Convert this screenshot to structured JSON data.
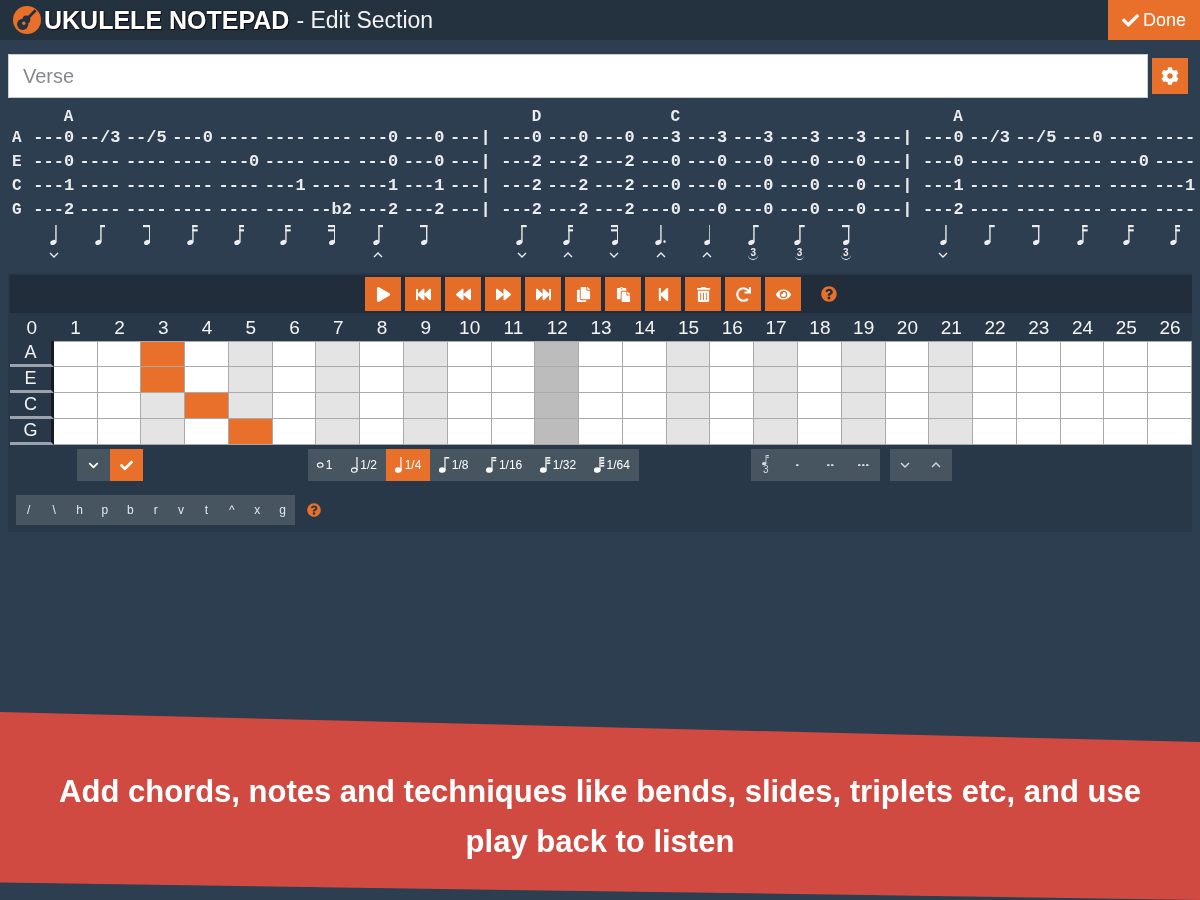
{
  "header": {
    "app_name": "UKULELE NOTEPAD",
    "title": "- Edit Section",
    "done_button": "Done"
  },
  "section_name": {
    "value": "Verse"
  },
  "tab": {
    "string_names": [
      "A",
      "E",
      "C",
      "G"
    ],
    "measures": [
      {
        "beats": [
          {
            "chord": "A",
            "strings": [
              "---0",
              "---0",
              "---1",
              "---2"
            ],
            "kind": "quarter",
            "accent": {
              "kind": "down"
            }
          },
          {
            "strings": [
              "--/3",
              "----",
              "----",
              "----"
            ],
            "kind": "eighth-beam-right"
          },
          {
            "strings": [
              "--/5",
              "----",
              "----",
              "----"
            ],
            "kind": "eighth-beam-left"
          },
          {
            "strings": [
              "---0",
              "----",
              "----",
              "----"
            ],
            "kind": "sixteenth-beam-right"
          },
          {
            "strings": [
              "----",
              "---0",
              "----",
              "----"
            ],
            "kind": "sixteenth-beam-right"
          },
          {
            "strings": [
              "----",
              "----",
              "---1",
              "----"
            ],
            "kind": "sixteenth-beam-right"
          },
          {
            "strings": [
              "----",
              "----",
              "----",
              "--b2"
            ],
            "kind": "sixteenth-beam-left"
          },
          {
            "strings": [
              "---0",
              "---0",
              "---1",
              "---2"
            ],
            "kind": "eighth-beam-right",
            "accent": {
              "kind": "up"
            }
          },
          {
            "strings": [
              "---0",
              "---0",
              "---1",
              "---2"
            ],
            "kind": "eighth-beam-left"
          }
        ],
        "bar": [
          "---|",
          "---|",
          "---|",
          "---|"
        ]
      },
      {
        "beats": [
          {
            "chord": "D",
            "strings": [
              "---0",
              "---2",
              "---2",
              "---2"
            ],
            "kind": "eighth-beam-right",
            "accent": {
              "kind": "down"
            }
          },
          {
            "strings": [
              "---0",
              "---2",
              "---2",
              "---2"
            ],
            "kind": "sixteenth-beam-right",
            "accent": {
              "kind": "up"
            }
          },
          {
            "strings": [
              "---0",
              "---2",
              "---2",
              "---2"
            ],
            "kind": "sixteenth-beam-left",
            "accent": {
              "kind": "down"
            }
          },
          {
            "chord": "C",
            "strings": [
              "---3",
              "---0",
              "---0",
              "---0"
            ],
            "kind": "dotted-quarter",
            "accent": {
              "kind": "up"
            }
          },
          {
            "strings": [
              "---3",
              "---0",
              "---0",
              "---0"
            ],
            "kind": "quarter",
            "accent": {
              "kind": "up"
            }
          },
          {
            "strings": [
              "---3",
              "---0",
              "---0",
              "---0"
            ],
            "kind": "eighth-beam-right",
            "tuplet": "3"
          },
          {
            "strings": [
              "---3",
              "---0",
              "---0",
              "---0"
            ],
            "kind": "eighth-beam-right",
            "tuplet": "3"
          },
          {
            "strings": [
              "---3",
              "---0",
              "---0",
              "---0"
            ],
            "kind": "eighth-beam-left",
            "tuplet": "3"
          }
        ],
        "bar": [
          "---|",
          "---|",
          "---|",
          "---|"
        ]
      },
      {
        "beats": [
          {
            "chord": "A",
            "strings": [
              "---0",
              "---0",
              "---1",
              "---2"
            ],
            "kind": "quarter",
            "accent": {
              "kind": "down"
            }
          },
          {
            "strings": [
              "--/3",
              "----",
              "----",
              "----"
            ],
            "kind": "eighth-beam-right"
          },
          {
            "strings": [
              "--/5",
              "----",
              "----",
              "----"
            ],
            "kind": "eighth-beam-left"
          },
          {
            "strings": [
              "---0",
              "----",
              "----",
              "----"
            ],
            "kind": "sixteenth-beam-right"
          },
          {
            "strings": [
              "----",
              "---0",
              "----",
              "----"
            ],
            "kind": "sixteenth-beam-right"
          },
          {
            "strings": [
              "----",
              "----",
              "---1",
              "----"
            ],
            "kind": "sixteenth-beam-right"
          }
        ]
      }
    ]
  },
  "fretboard": {
    "open_label": "0",
    "frets": [
      {
        "number": "1",
        "kind": "plain"
      },
      {
        "number": "2",
        "kind": "plain"
      },
      {
        "number": "3",
        "kind": "marker"
      },
      {
        "number": "4",
        "kind": "plain"
      },
      {
        "number": "5",
        "kind": "marker"
      },
      {
        "number": "6",
        "kind": "plain"
      },
      {
        "number": "7",
        "kind": "marker"
      },
      {
        "number": "8",
        "kind": "plain"
      },
      {
        "number": "9",
        "kind": "marker"
      },
      {
        "number": "10",
        "kind": "plain"
      },
      {
        "number": "11",
        "kind": "plain"
      },
      {
        "number": "12",
        "kind": "double-marker"
      },
      {
        "number": "13",
        "kind": "plain"
      },
      {
        "number": "14",
        "kind": "plain"
      },
      {
        "number": "15",
        "kind": "marker"
      },
      {
        "number": "16",
        "kind": "plain"
      },
      {
        "number": "17",
        "kind": "marker"
      },
      {
        "number": "18",
        "kind": "plain"
      },
      {
        "number": "19",
        "kind": "marker"
      },
      {
        "number": "20",
        "kind": "plain"
      },
      {
        "number": "21",
        "kind": "marker"
      },
      {
        "number": "22",
        "kind": "plain"
      },
      {
        "number": "23",
        "kind": "plain"
      },
      {
        "number": "24",
        "kind": "plain"
      },
      {
        "number": "25",
        "kind": "plain"
      },
      {
        "number": "26",
        "kind": "plain"
      }
    ],
    "strings": [
      {
        "name": "A",
        "cells": [
          {
            "selected": false
          },
          {
            "selected": false
          },
          {
            "selected": true
          },
          {
            "selected": false
          },
          {
            "selected": false
          },
          {
            "selected": false
          },
          {
            "selected": false
          },
          {
            "selected": false
          },
          {
            "selected": false
          },
          {
            "selected": false
          },
          {
            "selected": false
          },
          {
            "selected": false
          },
          {
            "selected": false
          },
          {
            "selected": false
          },
          {
            "selected": false
          },
          {
            "selected": false
          },
          {
            "selected": false
          },
          {
            "selected": false
          },
          {
            "selected": false
          },
          {
            "selected": false
          },
          {
            "selected": false
          },
          {
            "selected": false
          },
          {
            "selected": false
          },
          {
            "selected": false
          },
          {
            "selected": false
          },
          {
            "selected": false
          }
        ]
      },
      {
        "name": "E",
        "cells": [
          {
            "selected": false
          },
          {
            "selected": false
          },
          {
            "selected": true
          },
          {
            "selected": false
          },
          {
            "selected": false
          },
          {
            "selected": false
          },
          {
            "selected": false
          },
          {
            "selected": false
          },
          {
            "selected": false
          },
          {
            "selected": false
          },
          {
            "selected": false
          },
          {
            "selected": false
          },
          {
            "selected": false
          },
          {
            "selected": false
          },
          {
            "selected": false
          },
          {
            "selected": false
          },
          {
            "selected": false
          },
          {
            "selected": false
          },
          {
            "selected": false
          },
          {
            "selected": false
          },
          {
            "selected": false
          },
          {
            "selected": false
          },
          {
            "selected": false
          },
          {
            "selected": false
          },
          {
            "selected": false
          },
          {
            "selected": false
          }
        ]
      },
      {
        "name": "C",
        "cells": [
          {
            "selected": false
          },
          {
            "selected": false
          },
          {
            "selected": false
          },
          {
            "selected": true
          },
          {
            "selected": false
          },
          {
            "selected": false
          },
          {
            "selected": false
          },
          {
            "selected": false
          },
          {
            "selected": false
          },
          {
            "selected": false
          },
          {
            "selected": false
          },
          {
            "selected": false
          },
          {
            "selected": false
          },
          {
            "selected": false
          },
          {
            "selected": false
          },
          {
            "selected": false
          },
          {
            "selected": false
          },
          {
            "selected": false
          },
          {
            "selected": false
          },
          {
            "selected": false
          },
          {
            "selected": false
          },
          {
            "selected": false
          },
          {
            "selected": false
          },
          {
            "selected": false
          },
          {
            "selected": false
          },
          {
            "selected": false
          }
        ]
      },
      {
        "name": "G",
        "cells": [
          {
            "selected": false
          },
          {
            "selected": false
          },
          {
            "selected": false
          },
          {
            "selected": false
          },
          {
            "selected": true
          },
          {
            "selected": false
          },
          {
            "selected": false
          },
          {
            "selected": false
          },
          {
            "selected": false
          },
          {
            "selected": false
          },
          {
            "selected": false
          },
          {
            "selected": false
          },
          {
            "selected": false
          },
          {
            "selected": false
          },
          {
            "selected": false
          },
          {
            "selected": false
          },
          {
            "selected": false
          },
          {
            "selected": false
          },
          {
            "selected": false
          },
          {
            "selected": false
          },
          {
            "selected": false
          },
          {
            "selected": false
          },
          {
            "selected": false
          },
          {
            "selected": false
          },
          {
            "selected": false
          },
          {
            "selected": false
          }
        ]
      }
    ]
  },
  "note_lengths": [
    {
      "kind": "whole",
      "label": "1",
      "selected": false
    },
    {
      "kind": "half",
      "label": "1/2",
      "selected": false
    },
    {
      "kind": "quarter",
      "label": "1/4",
      "selected": true
    },
    {
      "kind": "eighth",
      "label": "1/8",
      "selected": false
    },
    {
      "kind": "sixteenth",
      "label": "1/16",
      "selected": false
    },
    {
      "kind": "thirty-second",
      "label": "1/32",
      "selected": false
    },
    {
      "kind": "sixty-fourth",
      "label": "1/64",
      "selected": false
    }
  ],
  "modifiers": [
    {
      "kind": "triplet",
      "label": "3"
    },
    {
      "kind": "dot"
    },
    {
      "kind": "double-dot"
    },
    {
      "kind": "triple-dot"
    }
  ],
  "techniques": [
    "/",
    "\\",
    "h",
    "p",
    "b",
    "r",
    "v",
    "t",
    "^",
    "x",
    "g"
  ],
  "caption": "Add chords, notes and techniques like bends, slides, triplets etc, and use play back to listen"
}
